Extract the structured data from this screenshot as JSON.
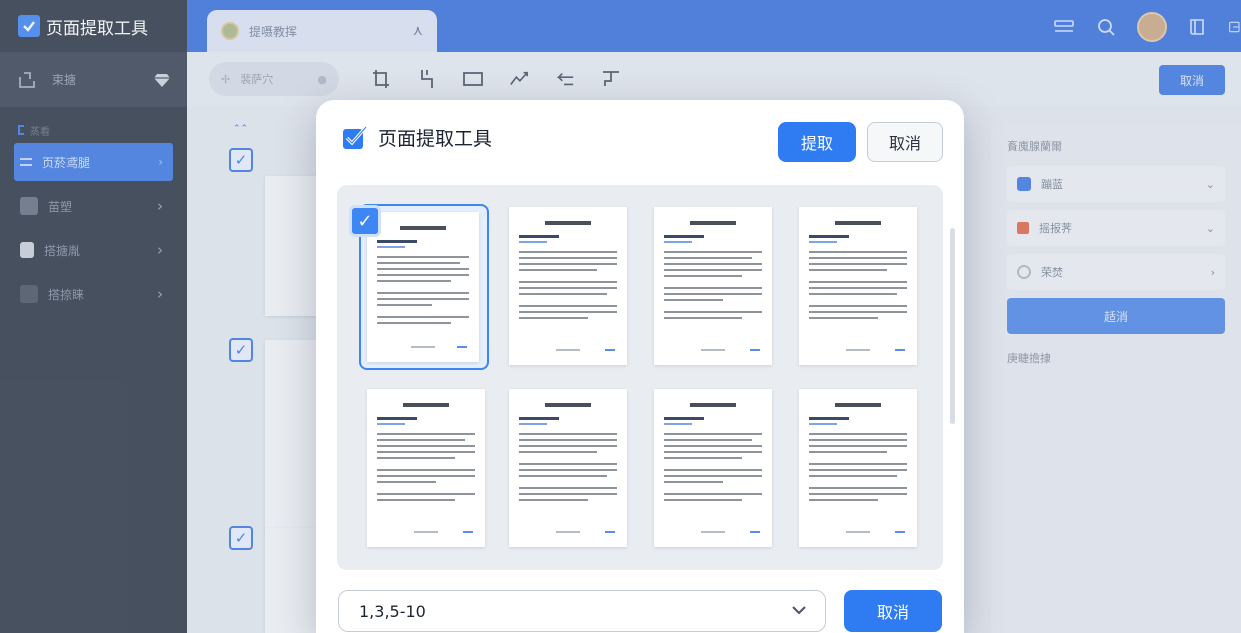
{
  "app": {
    "name": "页面提取工具",
    "top_item": "束搪"
  },
  "sidebar": {
    "section_label": "蒸看",
    "items": [
      {
        "label": "页菸鸢腿"
      },
      {
        "label": "苗塑"
      },
      {
        "label": "搭搪胤"
      },
      {
        "label": "搭捺睐"
      }
    ]
  },
  "tab": {
    "title": "提嗫教挥"
  },
  "toolbar": {
    "search_placeholder": "裴萨穴",
    "cancel_label": "取消"
  },
  "right_panel": {
    "title": "賌廆腺蘭爾",
    "rows": [
      {
        "label": "蹦蓝"
      },
      {
        "label": "摇报荠"
      },
      {
        "label": "荣焚"
      }
    ],
    "button_label": "趏消",
    "footer": "庚睫擔捸"
  },
  "modal": {
    "title": "页面提取工具",
    "extract_label": "提取",
    "cancel_label": "取消",
    "page_range_value": "1,3,5-10",
    "bottom_cancel_label": "取消",
    "selected_page": 1
  },
  "colors": {
    "accent": "#2f7bf2",
    "sidebar_bg": "#1d2635",
    "topbar_bg": "#2866d9"
  },
  "icons": [
    "checkbox-logo-icon",
    "diamond-icon",
    "search-icon",
    "close-icon",
    "chevron-right-icon",
    "chevron-down-icon",
    "check-icon"
  ]
}
